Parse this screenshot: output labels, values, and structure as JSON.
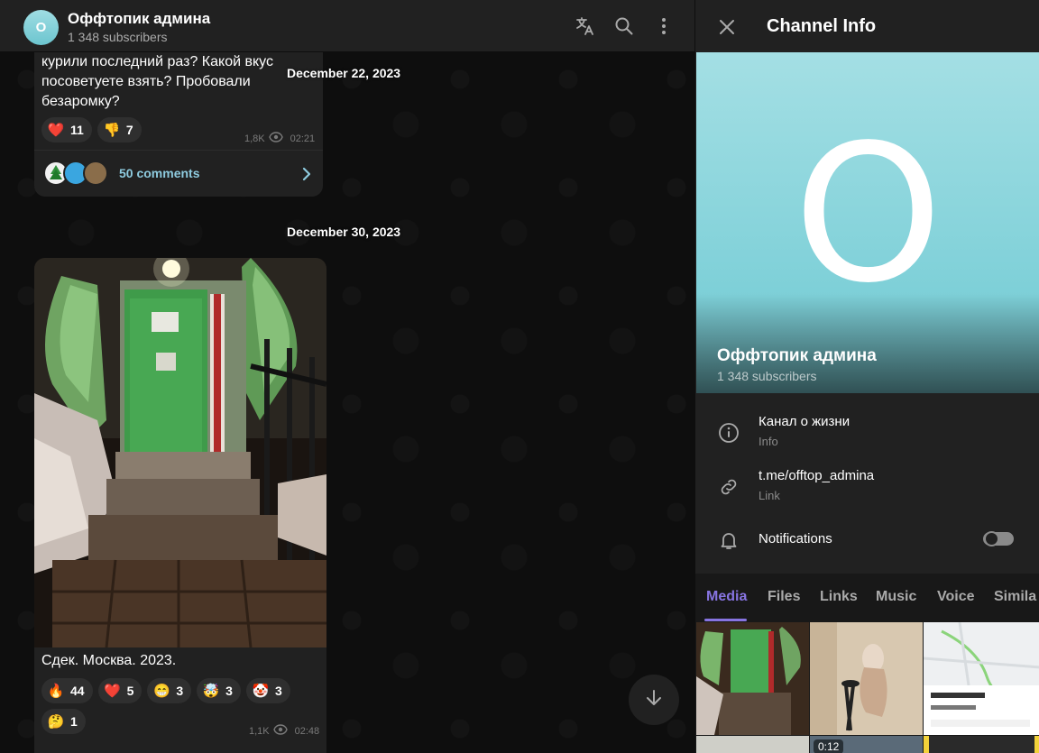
{
  "chat": {
    "title": "Оффтопик админа",
    "subtitle": "1 348 subscribers",
    "avatar_letter": "O"
  },
  "messages": [
    {
      "text": "курили последний раз? Какой вкус посоветуете взять? Пробовали безаромку?",
      "reactions": [
        {
          "emoji": "❤️",
          "count": "11"
        },
        {
          "emoji": "👎",
          "count": "7"
        }
      ],
      "views": "1,8K",
      "time": "02:21",
      "comments_label": "50 comments"
    },
    {
      "caption": "Сдек. Москва. 2023.",
      "reactions": [
        {
          "emoji": "🔥",
          "count": "44"
        },
        {
          "emoji": "❤️",
          "count": "5"
        },
        {
          "emoji": "😁",
          "count": "3"
        },
        {
          "emoji": "🤯",
          "count": "3"
        },
        {
          "emoji": "🤡",
          "count": "3"
        },
        {
          "emoji": "🤔",
          "count": "1"
        }
      ],
      "views": "1,1K",
      "time": "02:48"
    }
  ],
  "dates": [
    "December 22, 2023",
    "December 30, 2023"
  ],
  "panel": {
    "title": "Channel Info",
    "cover_letter": "O",
    "name": "Оффтопик админа",
    "subscribers": "1 348 subscribers",
    "info": {
      "main": "Канал о жизни",
      "sub": "Info"
    },
    "link": {
      "main": "t.me/offtop_admina",
      "sub": "Link"
    },
    "notifications": {
      "label": "Notifications",
      "enabled": false
    },
    "tabs": [
      "Media",
      "Files",
      "Links",
      "Music",
      "Voice",
      "Simila"
    ],
    "active_tab": "Media",
    "media": {
      "video_duration": "0:12"
    }
  },
  "icons": {
    "translate": "translate-icon",
    "search": "search-icon",
    "more": "more-vertical-icon",
    "close": "close-icon",
    "info": "info-icon",
    "link": "link-icon",
    "bell": "bell-icon",
    "views": "eye-icon",
    "arrow_down": "arrow-down-icon",
    "chevron": "chevron-right-icon"
  },
  "colors": {
    "accent": "#8774e1",
    "link": "#8ecbdf",
    "avatar": "#7ed0d8",
    "background": "#0f0f0f",
    "surface": "#212121"
  }
}
